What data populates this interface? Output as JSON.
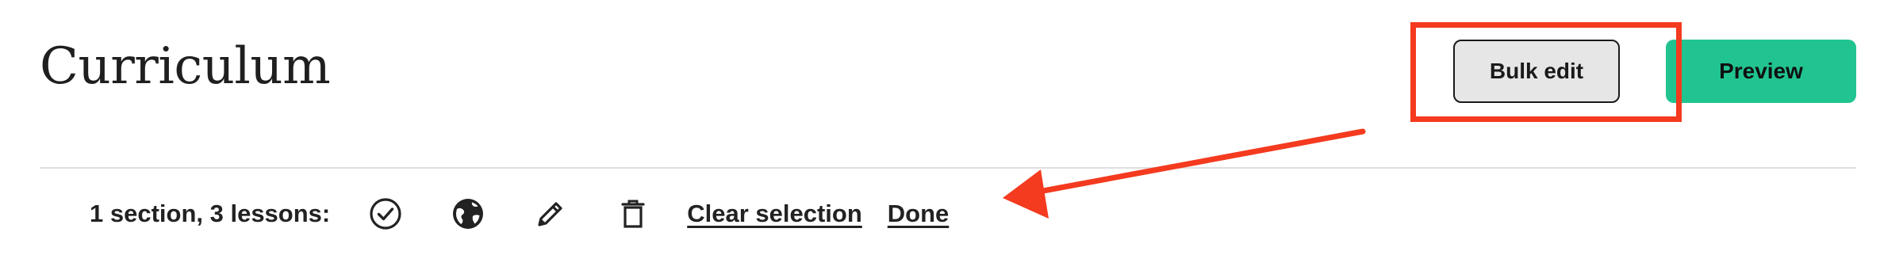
{
  "header": {
    "title": "Curriculum",
    "bulk_edit_label": "Bulk edit",
    "preview_label": "Preview"
  },
  "toolbar": {
    "selection_count": "1 section, 3 lessons:",
    "clear_selection_label": "Clear selection",
    "done_label": "Done",
    "icons": [
      "check-circle-icon",
      "globe-icon",
      "pencil-icon",
      "trash-icon"
    ]
  },
  "annotation": {
    "highlight_target": "bulk-edit-button",
    "color": "#f43a1f"
  },
  "colors": {
    "preview_button": "#21c490",
    "bulk_button": "#e6e6e6",
    "annotation": "#f43a1f"
  }
}
